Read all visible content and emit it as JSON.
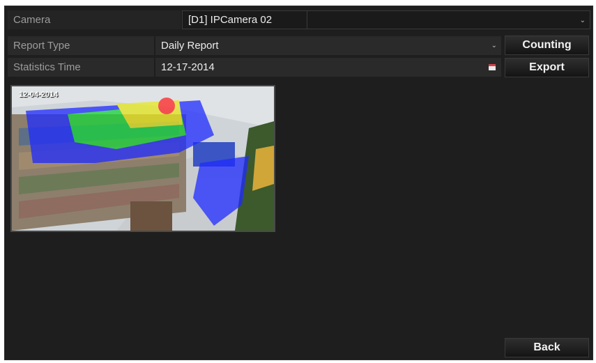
{
  "fields": {
    "camera": {
      "label": "Camera",
      "value": "[D1] IPCamera 02"
    },
    "report_type": {
      "label": "Report Type",
      "value": "Daily Report"
    },
    "statistics_time": {
      "label": "Statistics Time",
      "value": "12-17-2014"
    }
  },
  "buttons": {
    "counting": "Counting",
    "export": "Export",
    "back": "Back"
  },
  "preview": {
    "osd_text": "12-04-2014",
    "heatmap_colors": [
      "#1f2bff",
      "#19d63a",
      "#e8e81e",
      "#ff2424"
    ]
  },
  "icons": {
    "dropdown": "chevron-down-icon",
    "calendar": "calendar-icon"
  }
}
